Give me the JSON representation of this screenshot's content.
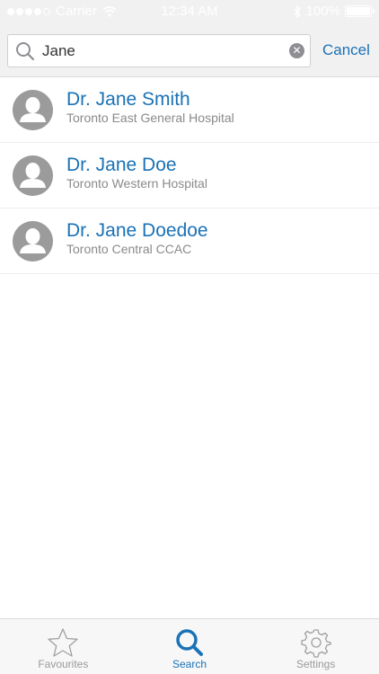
{
  "status_bar": {
    "carrier": "Carrier",
    "time": "12:34 AM",
    "battery": "100%",
    "signal_bars_filled": 4,
    "signal_bars_total": 5
  },
  "search": {
    "value": "Jane",
    "cancel_label": "Cancel"
  },
  "results": [
    {
      "name": "Dr. Jane Smith",
      "org": "Toronto East General Hospital"
    },
    {
      "name": "Dr. Jane Doe",
      "org": "Toronto Western Hospital"
    },
    {
      "name": "Dr. Jane Doedoe",
      "org": "Toronto Central CCAC"
    }
  ],
  "tabs": [
    {
      "label": "Favourites",
      "icon": "star-icon",
      "active": false
    },
    {
      "label": "Search",
      "icon": "search-icon",
      "active": true
    },
    {
      "label": "Settings",
      "icon": "gear-icon",
      "active": false
    }
  ],
  "colors": {
    "accent": "#1a72b6",
    "avatar_gray": "#9b9b9b",
    "header_bg": "#f1f1f2"
  }
}
